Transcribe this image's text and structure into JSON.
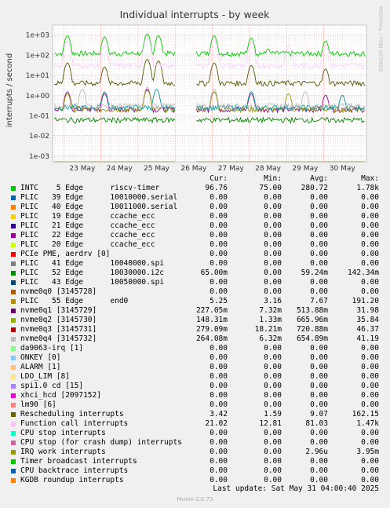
{
  "chart_data": {
    "type": "line",
    "title": "Individual interrupts - by week",
    "ylabel": "interrupts / second",
    "side_label": "RRDTOOL / TOBI OETIKER",
    "yscale": "log",
    "ylim": [
      0.0005,
      3000
    ],
    "y_ticks": [
      "1e+03",
      "1e+02",
      "1e+01",
      "1e+00",
      "1e-01",
      "1e-02",
      "1e-03"
    ],
    "y_tick_values": [
      1000,
      100,
      10,
      1,
      0.1,
      0.01,
      0.001
    ],
    "x_ticks": [
      "23 May",
      "24 May",
      "25 May",
      "26 May",
      "27 May",
      "28 May",
      "29 May",
      "30 May"
    ],
    "x_tick_days": [
      23,
      24,
      25,
      26,
      27,
      28,
      29,
      30
    ],
    "x_range_days": [
      22.7,
      31.15
    ],
    "gap_days": [
      26.0,
      26.55
    ],
    "grid": true,
    "colors": {
      "grid_major": "#ff9f9f",
      "grid_minor": "#e6c8c8",
      "background": "#ffffff"
    },
    "series": [
      {
        "name": "INTC    5 Edge      riscv-timer",
        "color": "#00cc00",
        "typical": 120,
        "spikes": [
          [
            23.1,
            900
          ],
          [
            24.1,
            800
          ],
          [
            25.25,
            1100
          ],
          [
            25.55,
            900
          ],
          [
            27.05,
            900
          ],
          [
            28.05,
            700
          ],
          [
            28.5,
            200
          ],
          [
            30.05,
            500
          ]
        ]
      },
      {
        "name": "PLIC   52 Edge      10030000.i2c",
        "color": "#ccff00",
        "typical": 0,
        "spikes": []
      },
      {
        "name": "nvme0q1 [3145729]",
        "color": "#990099",
        "typical": 0.2,
        "spikes": [
          [
            23.1,
            1.5
          ],
          [
            24.1,
            1.2
          ],
          [
            25.25,
            2
          ],
          [
            27.05,
            1.5
          ],
          [
            28.05,
            1.2
          ],
          [
            30.05,
            1
          ]
        ]
      },
      {
        "name": "nvme0q2 [3145730]",
        "color": "#999900",
        "typical": 0.2,
        "spikes": [
          [
            23.1,
            1.2
          ],
          [
            25.25,
            1.8
          ],
          [
            27.05,
            1.5
          ],
          [
            29.05,
            1.2
          ]
        ]
      },
      {
        "name": "nvme0q3 [3145731]",
        "color": "#009999",
        "typical": 0.25,
        "spikes": [
          [
            24.1,
            1.5
          ],
          [
            25.5,
            2
          ],
          [
            28.05,
            1.5
          ],
          [
            30.5,
            1
          ]
        ]
      },
      {
        "name": "nvme0q4 [3145732]",
        "color": "#bbbbbb",
        "typical": 0.3,
        "spikes": [
          [
            23.5,
            2
          ],
          [
            25.25,
            2.5
          ],
          [
            27.05,
            2
          ],
          [
            29.5,
            1.5
          ]
        ]
      },
      {
        "name": "Rescheduling interrupts",
        "color": "#555500",
        "typical": 4,
        "spikes": [
          [
            23.1,
            40
          ],
          [
            24.1,
            25
          ],
          [
            25.25,
            60
          ],
          [
            25.55,
            50
          ],
          [
            27.05,
            40
          ],
          [
            28.05,
            30
          ],
          [
            30.05,
            20
          ]
        ]
      },
      {
        "name": "Function call interrupts",
        "color": "#ffccff",
        "typical": 30,
        "spikes": [
          [
            23.1,
            500
          ],
          [
            24.1,
            300
          ],
          [
            25.25,
            800
          ],
          [
            27.05,
            600
          ],
          [
            28.05,
            400
          ],
          [
            29.05,
            300
          ],
          [
            30.05,
            300
          ]
        ]
      },
      {
        "name": "IRQ work interrupts",
        "color": "#889900",
        "typical": 3e-05,
        "spikes": []
      },
      {
        "name": "Timer broadcast interrupts",
        "color": "#008800",
        "typical": 0.06,
        "spikes": []
      }
    ]
  },
  "legend": {
    "headers": {
      "cur": "Cur:",
      "min": "Min:",
      "avg": "Avg:",
      "max": "Max:"
    },
    "rows": [
      {
        "label": "INTC    5 Edge      riscv-timer",
        "color": "#00cc00",
        "cur": "96.76",
        "min": "75.00",
        "avg": "280.72",
        "max": "1.78k"
      },
      {
        "label": "PLIC   39 Edge      10010000.serial",
        "color": "#0066b3",
        "cur": "0.00",
        "min": "0.00",
        "avg": "0.00",
        "max": "0.00"
      },
      {
        "label": "PLIC   40 Edge      10011000.serial",
        "color": "#ff8000",
        "cur": "0.00",
        "min": "0.00",
        "avg": "0.00",
        "max": "0.00"
      },
      {
        "label": "PLIC   19 Edge      ccache_ecc",
        "color": "#ffcc00",
        "cur": "0.00",
        "min": "0.00",
        "avg": "0.00",
        "max": "0.00"
      },
      {
        "label": "PLIC   21 Edge      ccache_ecc",
        "color": "#330099",
        "cur": "0.00",
        "min": "0.00",
        "avg": "0.00",
        "max": "0.00"
      },
      {
        "label": "PLIC   22 Edge      ccache_ecc",
        "color": "#990099",
        "cur": "0.00",
        "min": "0.00",
        "avg": "0.00",
        "max": "0.00"
      },
      {
        "label": "PLIC   20 Edge      ccache_ecc",
        "color": "#ccff00",
        "cur": "0.00",
        "min": "0.00",
        "avg": "0.00",
        "max": "0.00"
      },
      {
        "label": "PCIe PME, aerdrv [0]",
        "color": "#ff0000",
        "cur": "0.00",
        "min": "0.00",
        "avg": "0.00",
        "max": "0.00"
      },
      {
        "label": "PLIC   41 Edge      10040000.spi",
        "color": "#808080",
        "cur": "0.00",
        "min": "0.00",
        "avg": "0.00",
        "max": "0.00"
      },
      {
        "label": "PLIC   52 Edge      10030000.i2c",
        "color": "#008f00",
        "cur": "65.00m",
        "min": "0.00",
        "avg": "59.24m",
        "max": "142.34m"
      },
      {
        "label": "PLIC   43 Edge      10050000.spi",
        "color": "#00487d",
        "cur": "0.00",
        "min": "0.00",
        "avg": "0.00",
        "max": "0.00"
      },
      {
        "label": "nvme0q0 [3145728]",
        "color": "#b35a00",
        "cur": "0.00",
        "min": "0.00",
        "avg": "0.00",
        "max": "0.00"
      },
      {
        "label": "PLIC   55 Edge      end0",
        "color": "#b38f00",
        "cur": "5.25",
        "min": "3.16",
        "avg": "7.67",
        "max": "191.20"
      },
      {
        "label": "nvme0q1 [3145729]",
        "color": "#6b006b",
        "cur": "227.05m",
        "min": "7.32m",
        "avg": "513.88m",
        "max": "31.98"
      },
      {
        "label": "nvme0q2 [3145730]",
        "color": "#8fb300",
        "cur": "148.31m",
        "min": "1.33m",
        "avg": "665.96m",
        "max": "35.84"
      },
      {
        "label": "nvme0q3 [3145731]",
        "color": "#b30000",
        "cur": "279.09m",
        "min": "18.21m",
        "avg": "720.88m",
        "max": "46.37"
      },
      {
        "label": "nvme0q4 [3145732]",
        "color": "#bebebe",
        "cur": "264.08m",
        "min": "6.32m",
        "avg": "654.89m",
        "max": "41.19"
      },
      {
        "label": "da9063-irq [1]",
        "color": "#80ff80",
        "cur": "0.00",
        "min": "0.00",
        "avg": "0.00",
        "max": "0.00"
      },
      {
        "label": "ONKEY [0]",
        "color": "#80c9ff",
        "cur": "0.00",
        "min": "0.00",
        "avg": "0.00",
        "max": "0.00"
      },
      {
        "label": "ALARM [1]",
        "color": "#ffc080",
        "cur": "0.00",
        "min": "0.00",
        "avg": "0.00",
        "max": "0.00"
      },
      {
        "label": "LDO_LIM [8]",
        "color": "#ffe680",
        "cur": "0.00",
        "min": "0.00",
        "avg": "0.00",
        "max": "0.00"
      },
      {
        "label": "spi1.0 cd [15]",
        "color": "#aa80ff",
        "cur": "0.00",
        "min": "0.00",
        "avg": "0.00",
        "max": "0.00"
      },
      {
        "label": "xhci_hcd [2097152]",
        "color": "#ee00cc",
        "cur": "0.00",
        "min": "0.00",
        "avg": "0.00",
        "max": "0.00"
      },
      {
        "label": "lm90 [6]",
        "color": "#ff8080",
        "cur": "0.00",
        "min": "0.00",
        "avg": "0.00",
        "max": "0.00"
      },
      {
        "label": "Rescheduling interrupts",
        "color": "#666600",
        "cur": "3.42",
        "min": "1.59",
        "avg": "9.07",
        "max": "162.15"
      },
      {
        "label": "Function call interrupts",
        "color": "#ffbfff",
        "cur": "21.02",
        "min": "12.81",
        "avg": "81.03",
        "max": "1.47k"
      },
      {
        "label": "CPU stop interrupts",
        "color": "#00ffcc",
        "cur": "0.00",
        "min": "0.00",
        "avg": "0.00",
        "max": "0.00"
      },
      {
        "label": "CPU stop (for crash dump) interrupts",
        "color": "#cc6699",
        "cur": "0.00",
        "min": "0.00",
        "avg": "0.00",
        "max": "0.00"
      },
      {
        "label": "IRQ work interrupts",
        "color": "#999900",
        "cur": "0.00",
        "min": "0.00",
        "avg": "2.96u",
        "max": "3.95m"
      },
      {
        "label": "Timer broadcast interrupts",
        "color": "#00cc00",
        "cur": "0.00",
        "min": "0.00",
        "avg": "0.00",
        "max": "0.00"
      },
      {
        "label": "CPU backtrace interrupts",
        "color": "#0066b3",
        "cur": "0.00",
        "min": "0.00",
        "avg": "0.00",
        "max": "0.00"
      },
      {
        "label": "KGDB roundup interrupts",
        "color": "#ff8000",
        "cur": "0.00",
        "min": "0.00",
        "avg": "0.00",
        "max": "0.00"
      }
    ]
  },
  "footer": {
    "last_update": "Last update: Sat May 31 04:00:40 2025",
    "version": "Munin 2.0.73"
  }
}
